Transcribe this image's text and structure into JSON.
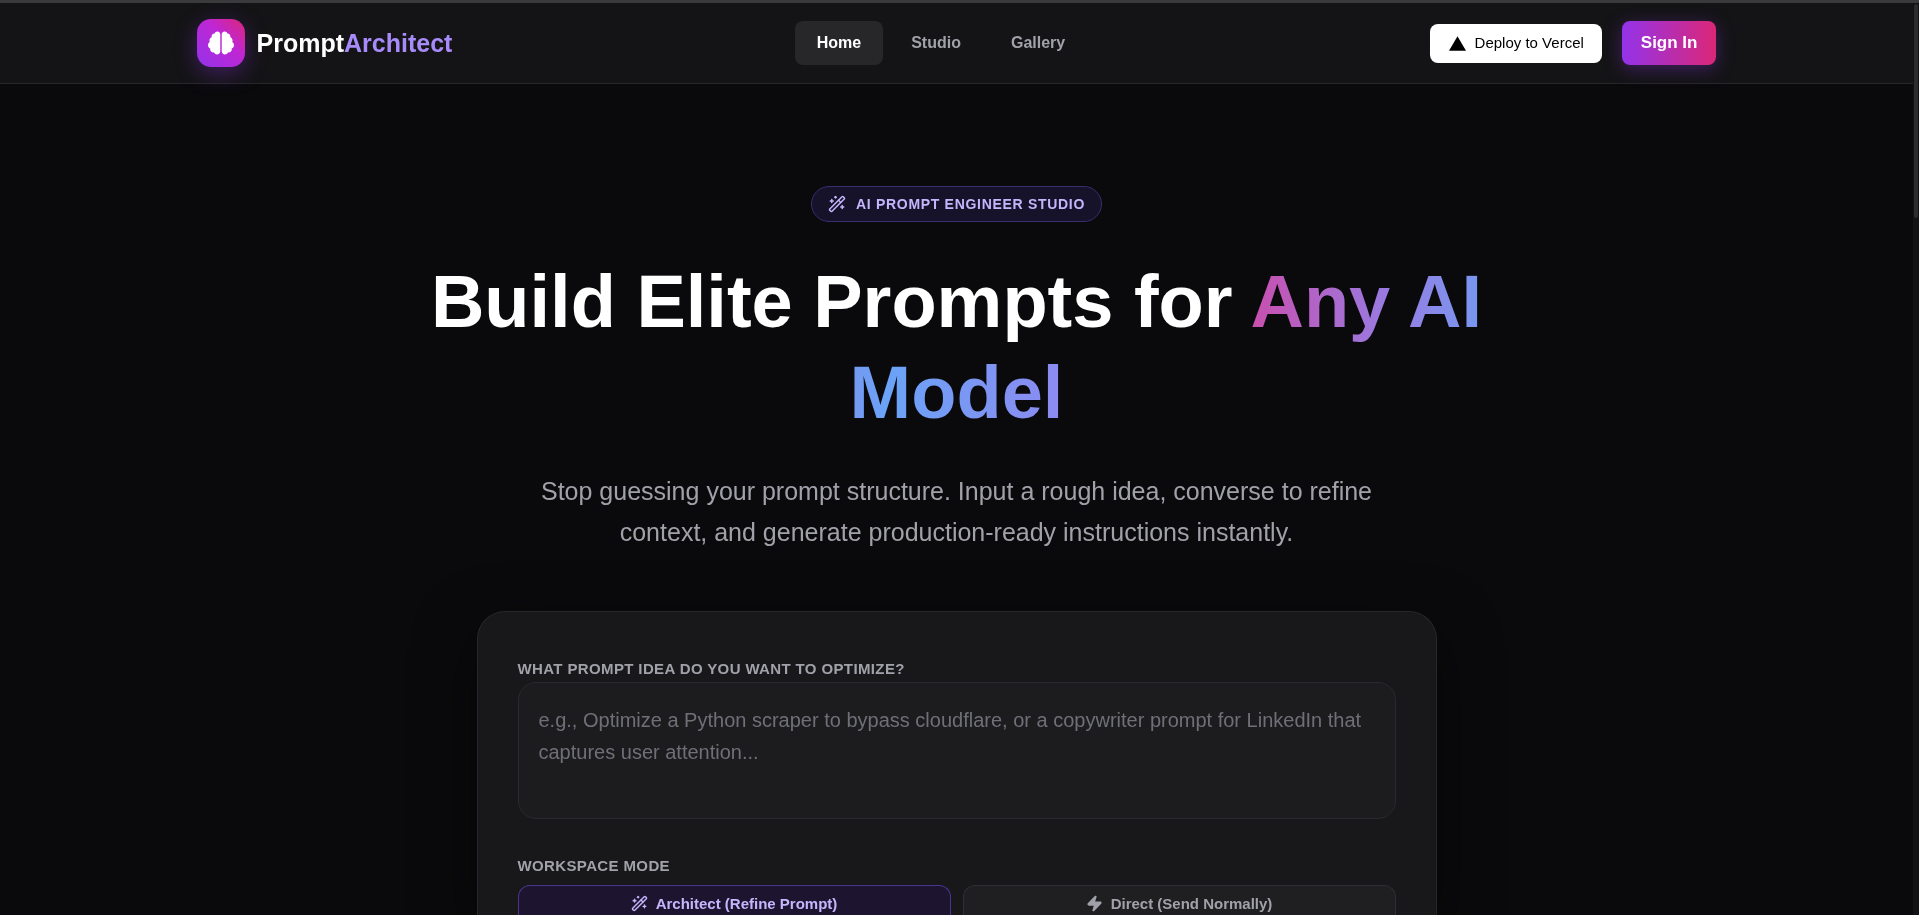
{
  "header": {
    "brand": {
      "name": "Prompt",
      "accent": "Architect"
    },
    "nav": [
      {
        "label": "Home",
        "selected": true
      },
      {
        "label": "Studio",
        "selected": false
      },
      {
        "label": "Gallery",
        "selected": false
      }
    ],
    "deploy_button": "Deploy to Vercel",
    "sign_in_button": "Sign In"
  },
  "hero": {
    "badge": "AI PROMPT ENGINEER STUDIO",
    "title": "Build Elite Prompts for",
    "title_highlight": "Any AI Model",
    "subtitle": "Stop guessing your prompt structure. Input a rough idea, converse to refine context, and generate production-ready instructions instantly."
  },
  "composer": {
    "idea_field": {
      "label": "WHAT PROMPT IDEA DO YOU WANT TO OPTIMIZE?",
      "placeholder": "e.g., Optimize a Python scraper to bypass cloudflare, or a copywriter prompt for LinkedIn that captures user attention..."
    },
    "workspace_mode": {
      "label": "WORKSPACE MODE",
      "options": [
        {
          "label": "Architect (Refine Prompt)",
          "selected": true
        },
        {
          "label": "Direct (Send Normally)",
          "selected": false
        }
      ]
    }
  }
}
